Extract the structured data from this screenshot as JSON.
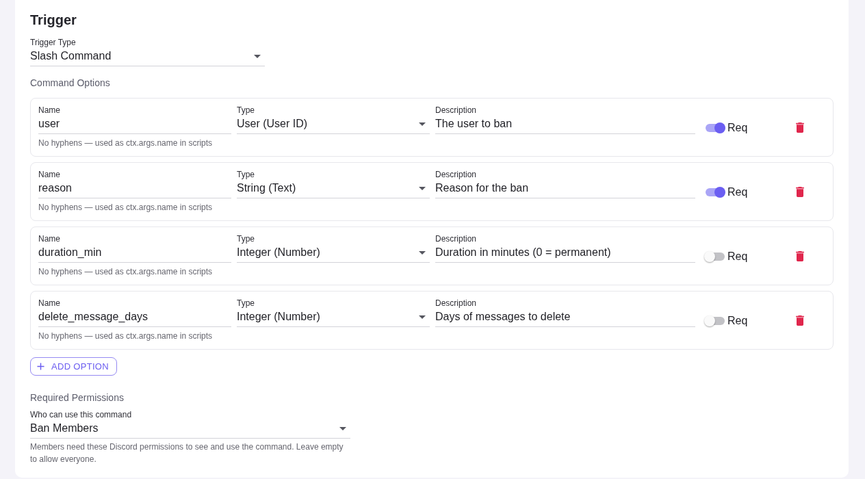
{
  "section": {
    "title": "Trigger"
  },
  "trigger_type": {
    "label": "Trigger Type",
    "value": "Slash Command"
  },
  "command_options": {
    "heading": "Command Options",
    "options": [
      {
        "name_label": "Name",
        "name": "user",
        "type_label": "Type",
        "type": "User (User ID)",
        "description_label": "Description",
        "description": "The user to ban",
        "required": true,
        "required_label": "Req",
        "hint": "No hyphens — used as ctx.args.name in scripts"
      },
      {
        "name_label": "Name",
        "name": "reason",
        "type_label": "Type",
        "type": "String (Text)",
        "description_label": "Description",
        "description": "Reason for the ban",
        "required": true,
        "required_label": "Req",
        "hint": "No hyphens — used as ctx.args.name in scripts"
      },
      {
        "name_label": "Name",
        "name": "duration_min",
        "type_label": "Type",
        "type": "Integer (Number)",
        "description_label": "Description",
        "description": "Duration in minutes (0 = permanent)",
        "required": false,
        "required_label": "Req",
        "hint": "No hyphens — used as ctx.args.name in scripts"
      },
      {
        "name_label": "Name",
        "name": "delete_message_days",
        "type_label": "Type",
        "type": "Integer (Number)",
        "description_label": "Description",
        "description": "Days of messages to delete",
        "required": false,
        "required_label": "Req",
        "hint": "No hyphens — used as ctx.args.name in scripts"
      }
    ],
    "add_button": "ADD OPTION"
  },
  "permissions": {
    "heading": "Required Permissions",
    "label": "Who can use this command",
    "value": "Ban Members",
    "hint": "Members need these Discord permissions to see and use the command. Leave empty to allow everyone."
  }
}
